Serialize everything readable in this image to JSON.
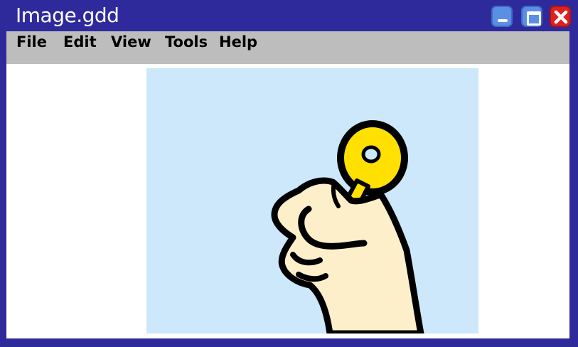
{
  "window": {
    "title": "Image.gdd"
  },
  "title_buttons": {
    "minimize": "minimize-icon",
    "maximize": "maximize-icon",
    "close": "close-icon"
  },
  "menu": {
    "items": [
      {
        "label": "File"
      },
      {
        "label": "Edit"
      },
      {
        "label": "View"
      },
      {
        "label": "Tools"
      },
      {
        "label": "Help"
      }
    ]
  },
  "canvas": {
    "image": "hand-holding-key",
    "background_color": "#cce8fa",
    "key_color": "#ffe000"
  },
  "colors": {
    "frame": "#2e2a9c",
    "menu_bar": "#bdbdbd",
    "minimize_button": "#5b8fe6",
    "close_button": "#e02020"
  }
}
